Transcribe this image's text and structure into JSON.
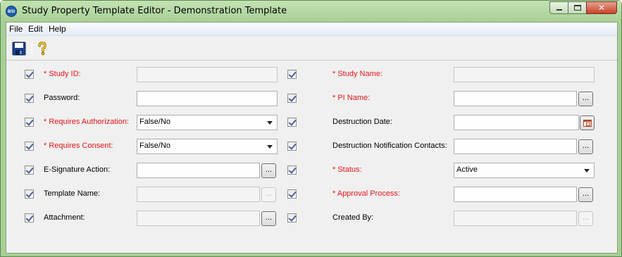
{
  "window": {
    "title": "Study Property Template Editor - Demonstration Template",
    "icon_text": "BSI",
    "minimize_glyph": "",
    "close_glyph": "✕"
  },
  "menu": {
    "file": "File",
    "edit": "Edit",
    "help": "Help"
  },
  "toolbar": {
    "save_icon": "save-icon",
    "help_icon": "help-icon"
  },
  "colors": {
    "required_label": "#e3141b",
    "checkbox_tick": "#4a5f97",
    "frame": "#a7cf95"
  },
  "left": {
    "study_id": {
      "label": "* Study ID:",
      "value": "",
      "checked": true
    },
    "password": {
      "label": "Password:",
      "value": "",
      "checked": true
    },
    "requires_authorization": {
      "label": "* Requires Authorization:",
      "value": "False/No",
      "checked": true
    },
    "requires_consent": {
      "label": "* Requires Consent:",
      "value": "False/No",
      "checked": true
    },
    "esignature_action": {
      "label": "E-Signature Action:",
      "value": "",
      "button": "...",
      "checked": true
    },
    "template_name": {
      "label": "Template Name:",
      "value": "",
      "button": "...",
      "checked": true
    },
    "attachment": {
      "label": "Attachment:",
      "value": "",
      "button": "...",
      "checked": true
    }
  },
  "right": {
    "study_name": {
      "label": "* Study Name:",
      "value": "",
      "checked": true
    },
    "pi_name": {
      "label": "* PI Name:",
      "value": "",
      "button": "...",
      "checked": true
    },
    "destruction_date": {
      "label": "Destruction Date:",
      "value": "",
      "checked": true
    },
    "destruction_contacts": {
      "label": "Destruction Notification Contacts:",
      "value": "",
      "button": "...",
      "checked": true
    },
    "status": {
      "label": "* Status:",
      "value": "Active",
      "checked": true
    },
    "approval_process": {
      "label": "* Approval Process:",
      "value": "",
      "button": "...",
      "checked": true
    },
    "created_by": {
      "label": "Created By:",
      "value": "",
      "button": "...",
      "checked": true
    }
  }
}
